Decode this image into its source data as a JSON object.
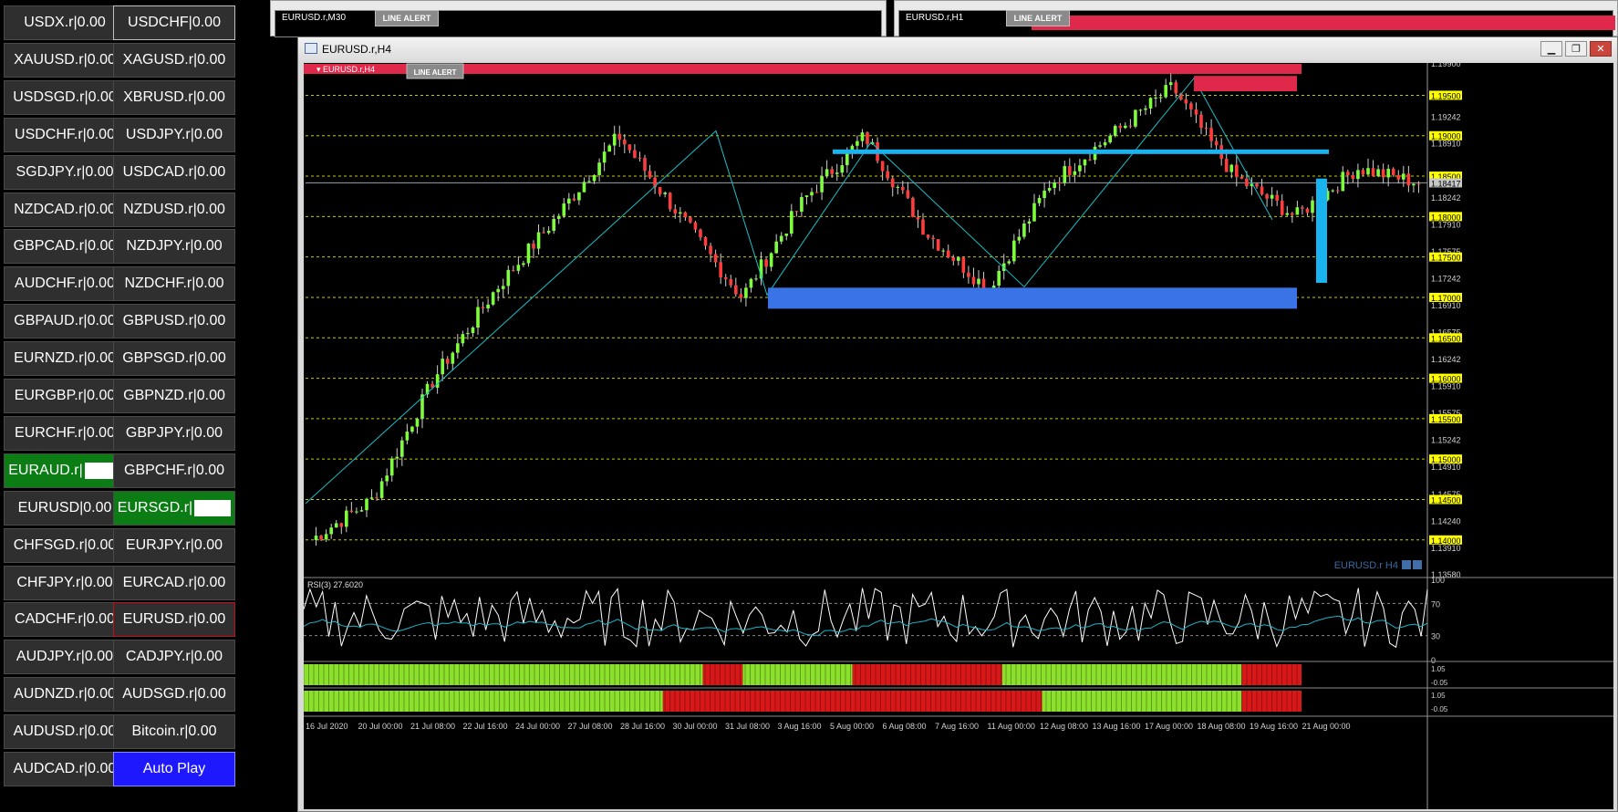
{
  "symbols": [
    [
      "USDX.r|0.00",
      "USDCHF|0.00"
    ],
    [
      "XAUUSD.r|0.00",
      "XAGUSD.r|0.00"
    ],
    [
      "USDSGD.r|0.00",
      "XBRUSD.r|0.00"
    ],
    [
      "USDCHF.r|0.00",
      "USDJPY.r|0.00"
    ],
    [
      "SGDJPY.r|0.00",
      "USDCAD.r|0.00"
    ],
    [
      "NZDCAD.r|0.00",
      "NZDUSD.r|0.00"
    ],
    [
      "GBPCAD.r|0.00",
      "NZDJPY.r|0.00"
    ],
    [
      "AUDCHF.r|0.00",
      "NZDCHF.r|0.00"
    ],
    [
      "GBPAUD.r|0.00",
      "GBPUSD.r|0.00"
    ],
    [
      "EURNZD.r|0.00",
      "GBPSGD.r|0.00"
    ],
    [
      "EURGBP.r|0.00",
      "GBPNZD.r|0.00"
    ],
    [
      "EURCHF.r|0.00",
      "GBPJPY.r|0.00"
    ],
    [
      "EURAUD.r|",
      "GBPCHF.r|0.00"
    ],
    [
      "EURUSD|0.00",
      "EURSGD.r|"
    ],
    [
      "CHFSGD.r|0.00",
      "EURJPY.r|0.00"
    ],
    [
      "CHFJPY.r|0.00",
      "EURCAD.r|0.00"
    ],
    [
      "CADCHF.r|0.00",
      "EURUSD.r|0.00"
    ],
    [
      "AUDJPY.r|0.00",
      "CADJPY.r|0.00"
    ],
    [
      "AUDNZD.r|0.00",
      "AUDSGD.r|0.00"
    ],
    [
      "AUDUSD.r|0.00",
      "Bitcoin.r|0.00"
    ],
    [
      "AUDCAD.r|0.00",
      "Auto Play"
    ]
  ],
  "bg_windows": [
    {
      "symbol": "EURUSD.r,M30",
      "button": "LINE ALERT"
    },
    {
      "symbol": "EURUSD.r,H1",
      "button": "LINE ALERT"
    }
  ],
  "main_window": {
    "title": "EURUSD.r,H4",
    "chart_label": "EURUSD.r,H4",
    "line_alert": "LINE ALERT",
    "watermark": "EURUSD.r H4",
    "minimize": "▁",
    "restore": "❐",
    "close": "✕"
  },
  "colors": {
    "bull": "#7cff3a",
    "bear": "#ff3c3c",
    "grid": "#c8c800",
    "trend": "#18c0c8",
    "zone_blue": "#3a73e6",
    "zone_cyan": "#19b4f0",
    "zone_red": "#e0284a",
    "rsi_main": "#ffffff",
    "rsi_signal": "#19b4c8",
    "bar_green": "#8ae02a",
    "bar_red": "#d81818"
  },
  "chart_data": {
    "type": "candlestick",
    "ylim": [
      1.1358,
      1.199
    ],
    "price_levels": [
      1.195,
      1.19,
      1.185,
      1.18,
      1.175,
      1.17,
      1.165,
      1.16,
      1.155,
      1.15,
      1.145,
      1.14
    ],
    "axis_ticks": [
      "1.19900",
      "1.19242",
      "1.18910",
      "1.18417",
      "1.18242",
      "1.17910",
      "1.17575",
      "1.17242",
      "1.16910",
      "1.16575",
      "1.16242",
      "1.15910",
      "1.15575",
      "1.15242",
      "1.14910",
      "1.14575",
      "1.14240",
      "1.13910",
      "1.13580"
    ],
    "current_price": "1.18417",
    "x_labels": [
      "16 Jul 2020",
      "20 Jul 00:00",
      "21 Jul 08:00",
      "22 Jul 16:00",
      "24 Jul 00:00",
      "27 Jul 08:00",
      "28 Jul 16:00",
      "30 Jul 00:00",
      "31 Jul 08:00",
      "3 Aug 16:00",
      "5 Aug 00:00",
      "6 Aug 08:00",
      "7 Aug 16:00",
      "11 Aug 00:00",
      "12 Aug 08:00",
      "13 Aug 16:00",
      "17 Aug 00:00",
      "18 Aug 08:00",
      "19 Aug 16:00",
      "21 Aug 00:00"
    ],
    "swing_closes": [
      1.14,
      1.145,
      1.16,
      1.171,
      1.18,
      1.19,
      1.18,
      1.17,
      1.182,
      1.19,
      1.178,
      1.171,
      1.184,
      1.19,
      1.196,
      1.185,
      1.18,
      1.186,
      1.1842
    ],
    "zones": [
      {
        "name": "support",
        "from": 1.1712,
        "to": 1.1688
      },
      {
        "name": "resistance",
        "from": 1.1882,
        "to": 1.1876
      },
      {
        "name": "supply",
        "from": 1.1972,
        "to": 1.1955
      }
    ],
    "rsi": {
      "label": "RSI(3) 27.6020",
      "levels": [
        100,
        70,
        30,
        0
      ],
      "value": 27.602
    },
    "indicator_rows": [
      {
        "min": -0.05,
        "max": 1.05
      },
      {
        "min": -0.05,
        "max": 1.05
      }
    ]
  }
}
